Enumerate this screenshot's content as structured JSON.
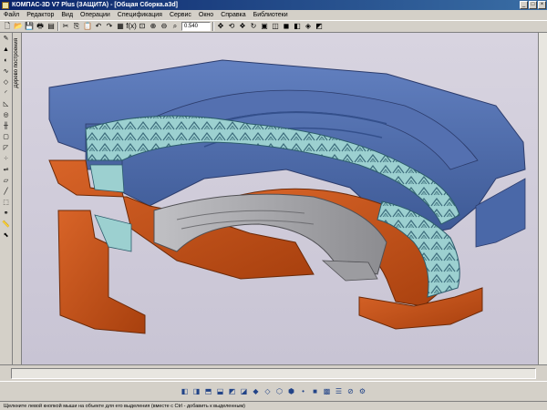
{
  "window": {
    "title": "КОМПАС-3D V7 Plus (ЗАЩИТА) - [Общая Сборка.a3d]",
    "minimize_glyph": "_",
    "maximize_glyph": "□",
    "close_glyph": "×"
  },
  "menu": {
    "items": [
      {
        "label": "Файл",
        "name": "menu-file"
      },
      {
        "label": "Редактор",
        "name": "menu-editor"
      },
      {
        "label": "Вид",
        "name": "menu-view"
      },
      {
        "label": "Операции",
        "name": "menu-operations"
      },
      {
        "label": "Спецификация",
        "name": "menu-specification"
      },
      {
        "label": "Сервис",
        "name": "menu-service"
      },
      {
        "label": "Окно",
        "name": "menu-window"
      },
      {
        "label": "Справка",
        "name": "menu-help"
      },
      {
        "label": "Библиотеки",
        "name": "menu-libraries"
      }
    ]
  },
  "toolbar": {
    "zoom_value": "0.540",
    "icons": [
      {
        "name": "new-file-icon",
        "glyph": "🗋"
      },
      {
        "name": "open-file-icon",
        "glyph": "📂"
      },
      {
        "name": "save-icon",
        "glyph": "💾"
      },
      {
        "name": "print-icon",
        "glyph": "🖶"
      },
      {
        "name": "preview-icon",
        "glyph": "▤"
      },
      {
        "name": "cut-icon",
        "glyph": "✂"
      },
      {
        "name": "copy-icon",
        "glyph": "⎘"
      },
      {
        "name": "paste-icon",
        "glyph": "📋"
      },
      {
        "name": "undo-icon",
        "glyph": "↶"
      },
      {
        "name": "redo-icon",
        "glyph": "↷"
      },
      {
        "name": "properties-icon",
        "glyph": "▦"
      },
      {
        "name": "variables-icon",
        "glyph": "f(x)"
      },
      {
        "name": "zoom-window-icon",
        "glyph": "⊡"
      },
      {
        "name": "zoom-in-icon",
        "glyph": "⊕"
      },
      {
        "name": "zoom-out-icon",
        "glyph": "⊖"
      },
      {
        "name": "zoom-all-icon",
        "glyph": "⌕"
      }
    ],
    "icons_right": [
      {
        "name": "pan-icon",
        "glyph": "✥"
      },
      {
        "name": "rotate-icon",
        "glyph": "⟲"
      },
      {
        "name": "orient-icon",
        "glyph": "❖"
      },
      {
        "name": "refresh-icon",
        "glyph": "↻"
      },
      {
        "name": "wireframe-icon",
        "glyph": "▣"
      },
      {
        "name": "hidden-lines-icon",
        "glyph": "◫"
      },
      {
        "name": "shaded-icon",
        "glyph": "◼"
      },
      {
        "name": "shaded-edges-icon",
        "glyph": "◧"
      },
      {
        "name": "perspective-icon",
        "glyph": "◈"
      },
      {
        "name": "section-icon",
        "glyph": "◩"
      }
    ]
  },
  "left_toolbar": {
    "tree_tab_label": "Дерево построения",
    "icons": [
      {
        "name": "sketch-icon",
        "glyph": "✎"
      },
      {
        "name": "extrude-icon",
        "glyph": "▲"
      },
      {
        "name": "rotate-op-icon",
        "glyph": "◐"
      },
      {
        "name": "kinematic-icon",
        "glyph": "∿"
      },
      {
        "name": "loft-icon",
        "glyph": "◇"
      },
      {
        "name": "fillet-icon",
        "glyph": "◜"
      },
      {
        "name": "chamfer-icon",
        "glyph": "◺"
      },
      {
        "name": "hole-icon",
        "glyph": "◎"
      },
      {
        "name": "rib-icon",
        "glyph": "╫"
      },
      {
        "name": "shell-icon",
        "glyph": "▢"
      },
      {
        "name": "slope-icon",
        "glyph": "◸"
      },
      {
        "name": "array-icon",
        "glyph": "⁘"
      },
      {
        "name": "mirror-icon",
        "glyph": "⇌"
      },
      {
        "name": "plane-icon",
        "glyph": "▱"
      },
      {
        "name": "axis-icon",
        "glyph": "╱"
      },
      {
        "name": "component-icon",
        "glyph": "⬚"
      },
      {
        "name": "mate-icon",
        "glyph": "⚭"
      },
      {
        "name": "measure-icon",
        "glyph": "📏"
      },
      {
        "name": "select-icon",
        "glyph": "⬉"
      }
    ]
  },
  "bottom_toolbar": {
    "icons": [
      {
        "name": "view-front-icon",
        "glyph": "◧"
      },
      {
        "name": "view-back-icon",
        "glyph": "◨"
      },
      {
        "name": "view-top-icon",
        "glyph": "⬒"
      },
      {
        "name": "view-bottom-icon",
        "glyph": "⬓"
      },
      {
        "name": "view-left-icon",
        "glyph": "◩"
      },
      {
        "name": "view-right-icon",
        "glyph": "◪"
      },
      {
        "name": "view-iso-icon",
        "glyph": "◆"
      },
      {
        "name": "view-dimetric-icon",
        "glyph": "◇"
      },
      {
        "name": "filter-edge-icon",
        "glyph": "⬡"
      },
      {
        "name": "filter-face-icon",
        "glyph": "⬢"
      },
      {
        "name": "filter-vertex-icon",
        "glyph": "•"
      },
      {
        "name": "filter-body-icon",
        "glyph": "■"
      },
      {
        "name": "filter-component-icon",
        "glyph": "▩"
      },
      {
        "name": "select-all-icon",
        "glyph": "☰"
      },
      {
        "name": "deselect-icon",
        "glyph": "⊘"
      },
      {
        "name": "settings-icon",
        "glyph": "⚙"
      }
    ]
  },
  "status": {
    "hint": "Щелкните левой кнопкой мыши на объекте для его выделения (вместе с Ctrl - добавить к выделенным)"
  },
  "colors": {
    "housing_blue": "#4a6aa8",
    "seal_orange": "#c8521c",
    "teeth_cyan": "#8cc8c8",
    "bearing_gray": "#a8a8ac",
    "viewport_bg": "#d0ccdc"
  }
}
